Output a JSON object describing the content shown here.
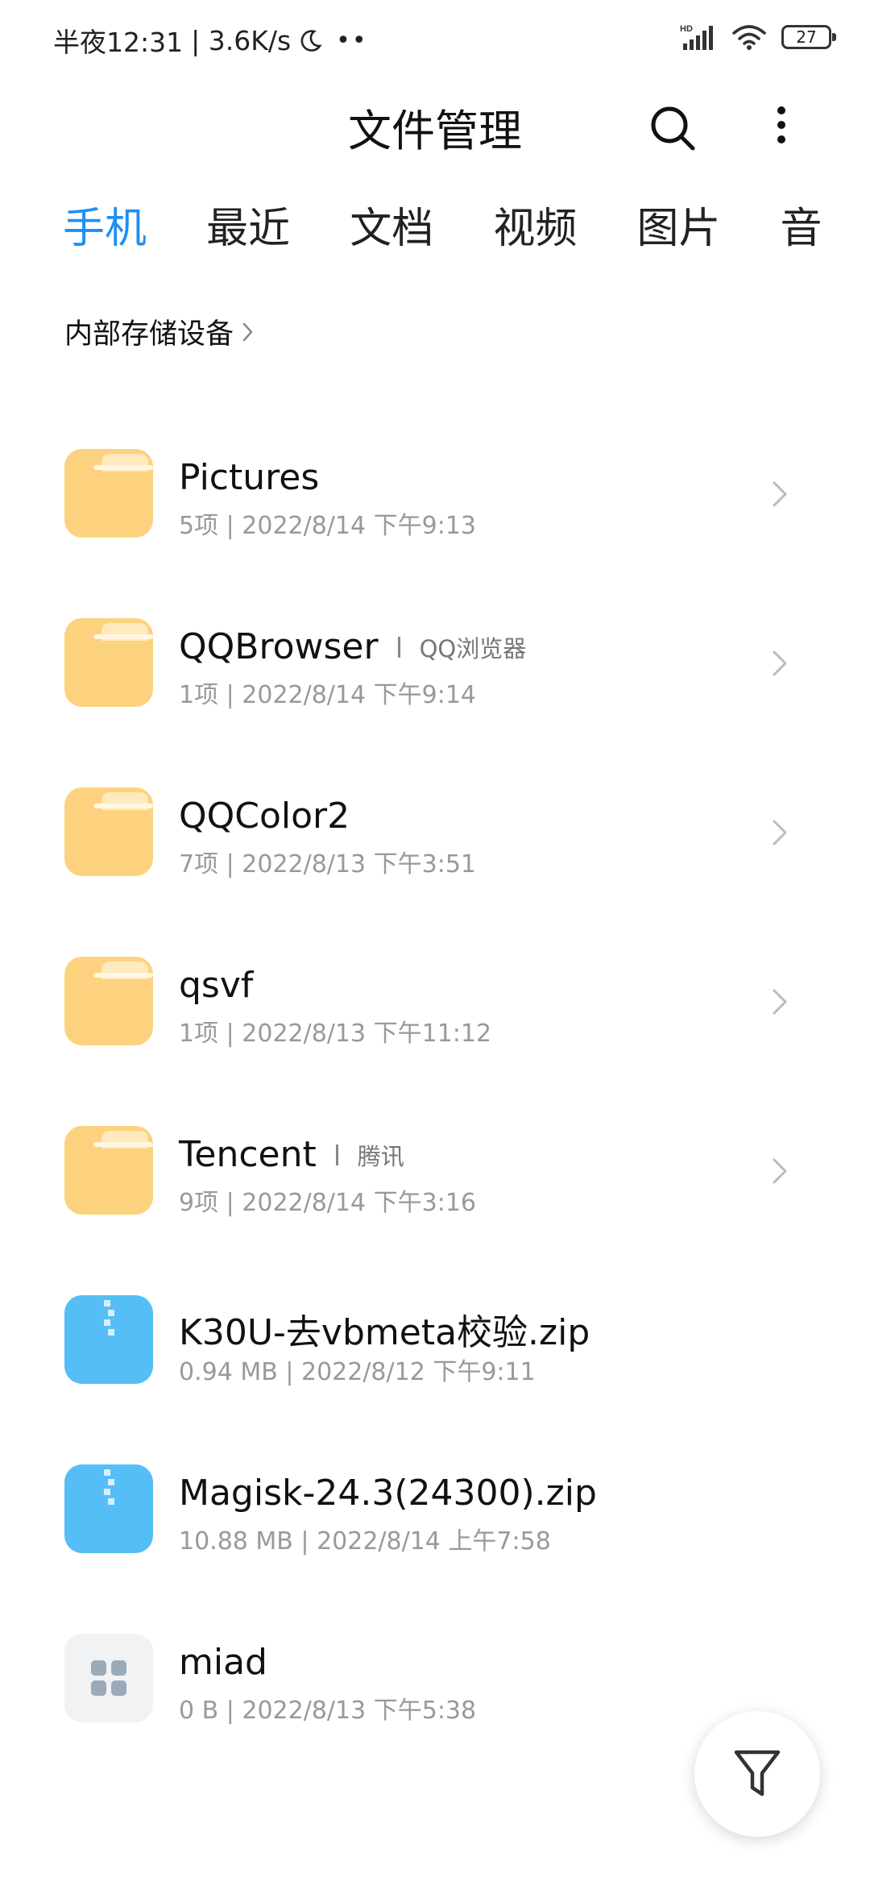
{
  "status_bar": {
    "time": "半夜12:31",
    "net_speed": "| 3.6K/s",
    "network_badge": "HD",
    "battery": "27",
    "icons": [
      "moon-icon",
      "dots-icon",
      "signal-icon",
      "wifi-icon",
      "battery-icon"
    ]
  },
  "header": {
    "title": "文件管理",
    "icons": [
      "search-icon",
      "more-vertical-icon"
    ]
  },
  "tabs": [
    {
      "label": "手机",
      "active": true
    },
    {
      "label": "最近",
      "active": false
    },
    {
      "label": "文档",
      "active": false
    },
    {
      "label": "视频",
      "active": false
    },
    {
      "label": "图片",
      "active": false
    },
    {
      "label": "音",
      "active": false
    }
  ],
  "breadcrumb": {
    "label": "内部存储设备"
  },
  "files": [
    {
      "name": "Pictures",
      "alias": "",
      "meta": "5项  |  2022/8/14 下午9:13",
      "kind": "folder"
    },
    {
      "name": "QQBrowser",
      "alias": "QQ浏览器",
      "meta": "1项  |  2022/8/14 下午9:14",
      "kind": "folder"
    },
    {
      "name": "QQColor2",
      "alias": "",
      "meta": "7项  |  2022/8/13 下午3:51",
      "kind": "folder"
    },
    {
      "name": "qsvf",
      "alias": "",
      "meta": "1项  |  2022/8/13 下午11:12",
      "kind": "folder"
    },
    {
      "name": "Tencent",
      "alias": "腾讯",
      "meta": "9项  |  2022/8/14 下午3:16",
      "kind": "folder"
    },
    {
      "name": "K30U-去vbmeta校验.zip",
      "alias": "",
      "meta": "0.94 MB  |  2022/8/12 下午9:11",
      "kind": "zip"
    },
    {
      "name": "Magisk-24.3(24300).zip",
      "alias": "",
      "meta": "10.88 MB  |  2022/8/14 上午7:58",
      "kind": "zip"
    },
    {
      "name": "miad",
      "alias": "",
      "meta": "0 B  |  2022/8/13 下午5:38",
      "kind": "app"
    }
  ],
  "fab": {
    "icon": "filter-icon"
  },
  "colors": {
    "accent": "#1f8ff4",
    "folder": "#fdd27f",
    "zip": "#56bef6",
    "meta_text": "#999999"
  }
}
